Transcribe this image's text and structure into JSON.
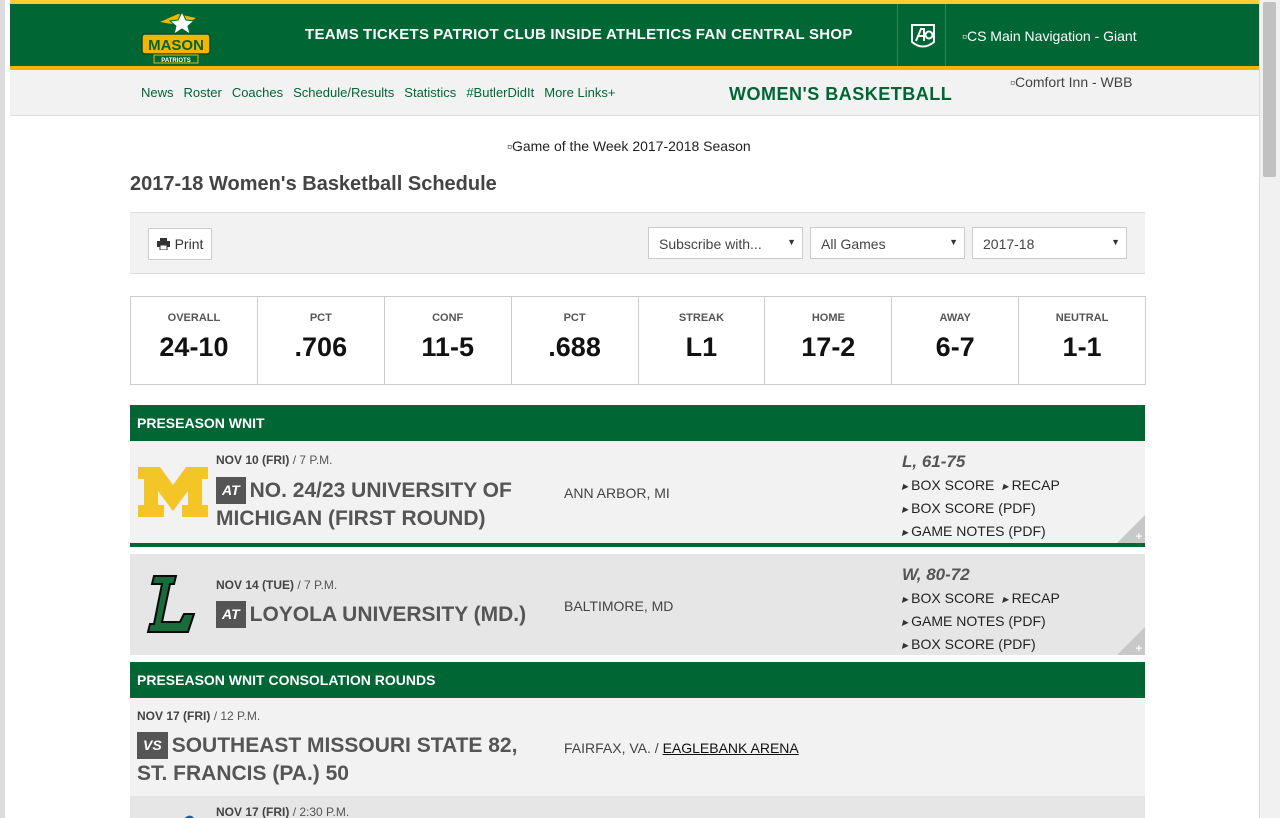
{
  "header": {
    "logo_text": "MASON",
    "logo_sub": "PATRIOTS",
    "nav": [
      "TEAMS",
      "TICKETS",
      "PATRIOT CLUB",
      "INSIDE ATHLETICS",
      "FAN CENTRAL",
      "SHOP"
    ],
    "sponsor_img_alt": "CS Main Navigation - Giant"
  },
  "subnav": {
    "links": [
      "News",
      "Roster",
      "Coaches",
      "Schedule/Results",
      "Statistics",
      "#ButlerDidIt",
      "More Links+"
    ],
    "sport_title": "WOMEN'S BASKETBALL",
    "sponsor_img_alt": "Comfort Inn - WBB"
  },
  "banner_img_alt": "Game of the Week 2017-2018 Season",
  "page_title": "2017-18 Women's Basketball Schedule",
  "toolbar": {
    "print_label": "Print",
    "subscribe": "Subscribe with...",
    "filter": "All Games",
    "season": "2017-18"
  },
  "stats": [
    {
      "label": "OVERALL",
      "value": "24-10"
    },
    {
      "label": "PCT",
      "value": ".706"
    },
    {
      "label": "CONF",
      "value": "11-5"
    },
    {
      "label": "PCT",
      "value": ".688"
    },
    {
      "label": "STREAK",
      "value": "L1"
    },
    {
      "label": "HOME",
      "value": "17-2"
    },
    {
      "label": "AWAY",
      "value": "6-7"
    },
    {
      "label": "NEUTRAL",
      "value": "1-1"
    }
  ],
  "sections": [
    {
      "title": "PRESEASON WNIT"
    },
    {
      "title": "PRESEASON WNIT CONSOLATION ROUNDS"
    }
  ],
  "games": [
    {
      "date": "NOV 10 (FRI)",
      "time": "/ 7 P.M.",
      "badge": "AT",
      "opponent_line1": "NO. 24/23 UNIVERSITY OF",
      "opponent_line2": "MICHIGAN (FIRST ROUND)",
      "location": "ANN ARBOR, MI",
      "result": "L, 61-75",
      "links": [
        "BOX SCORE",
        "RECAP",
        "BOX SCORE (PDF)",
        "GAME NOTES (PDF)"
      ]
    },
    {
      "date": "NOV 14 (TUE)",
      "time": "/ 7 P.M.",
      "badge": "AT",
      "opponent_line1": "LOYOLA UNIVERSITY (MD.)",
      "location": "BALTIMORE, MD",
      "result": "W, 80-72",
      "links": [
        "BOX SCORE",
        "RECAP",
        "GAME NOTES (PDF)",
        "BOX SCORE (PDF)"
      ]
    },
    {
      "date": "NOV 17 (FRI)",
      "time": "/ 12 P.M.",
      "badge": "VS",
      "opponent_line1": "SOUTHEAST MISSOURI STATE 82,",
      "opponent_line2": "ST. FRANCIS (PA.) 50",
      "location": "FAIRFAX, VA. /",
      "venue": "EAGLEBANK ARENA"
    },
    {
      "date": "NOV 17 (FRI)",
      "time": "/ 2:30 P.M."
    }
  ],
  "colors": {
    "green": "#006633",
    "gold": "#ffcc33"
  }
}
